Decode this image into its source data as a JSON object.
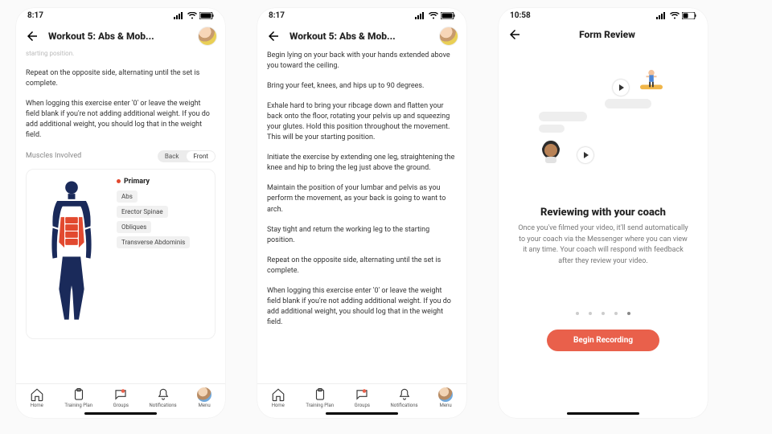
{
  "screen1": {
    "time": "8:17",
    "header_title": "Workout 5: Abs & Mob...",
    "para_top_cut": "starting position.",
    "para1": "Repeat on the opposite side, alternating until the set is complete.",
    "para2": "When logging this exercise enter '0' or leave the weight field blank if you're not adding additional weight. If you do add additional weight, you should log that in the weight field.",
    "section_label": "Muscles Involved",
    "toggle_back": "Back",
    "toggle_front": "Front",
    "primary_label": "Primary",
    "muscles": [
      "Abs",
      "Erector Spinae",
      "Obliques",
      "Transverse Abdominis"
    ]
  },
  "screen2": {
    "time": "8:17",
    "header_title": "Workout 5: Abs & Mob...",
    "p1": "Begin lying on your back with your hands extended above you toward the ceiling.",
    "p2": "Bring your feet, knees, and hips up to 90 degrees.",
    "p3": "Exhale hard to bring your ribcage down and flatten your back onto the floor, rotating your pelvis up and squeezing your glutes. Hold this position throughout the movement. This will be your starting position.",
    "p4": "Initiate the exercise by extending one leg, straightening the knee and hip to bring the leg just above the ground.",
    "p5": "Maintain the position of your lumbar and pelvis as you perform the movement, as your back is going to want to arch.",
    "p6": "Stay tight and return the working leg to the starting position.",
    "p7": "Repeat on the opposite side, alternating until the set is complete.",
    "p8": "When logging this exercise enter '0' or leave the weight field blank if you're not adding additional weight. If you do add additional weight, you should log that in the weight field."
  },
  "screen3": {
    "time": "10:58",
    "header_title": "Form Review",
    "review_title": "Reviewing with your coach",
    "review_desc": "Once you've filmed your video, it'll send automatically to your coach via the Messenger where you can view it any time. Your coach will respond with feedback after they review your video.",
    "cta": "Begin Recording",
    "page_dots": {
      "count": 5,
      "active_index": 4
    }
  },
  "tabbar": {
    "items": [
      {
        "key": "home",
        "label": "Home"
      },
      {
        "key": "training",
        "label": "Training Plan"
      },
      {
        "key": "groups",
        "label": "Groups"
      },
      {
        "key": "notifications",
        "label": "Notifications"
      },
      {
        "key": "menu",
        "label": "Menu"
      }
    ]
  }
}
